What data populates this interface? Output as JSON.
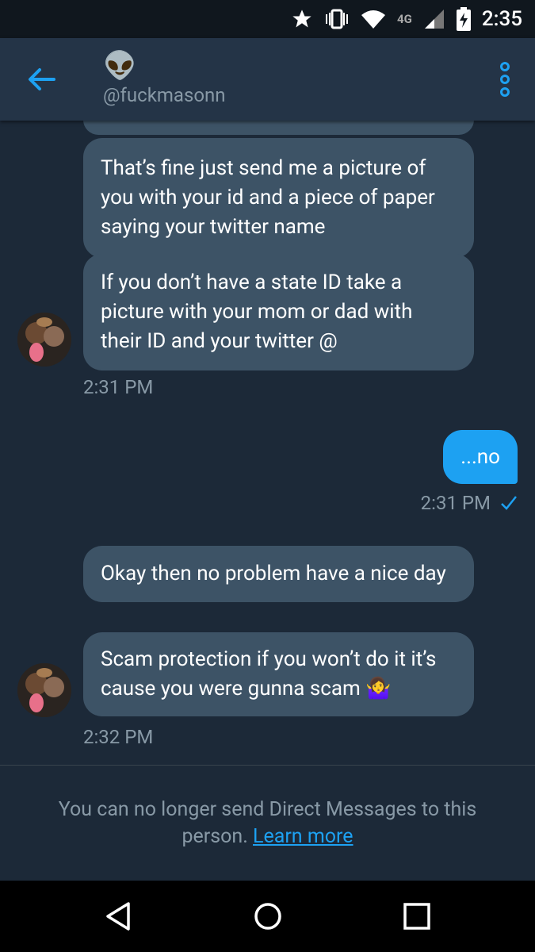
{
  "status_bar": {
    "time": "2:35",
    "network": "4G"
  },
  "header": {
    "avatar_emoji": "👽",
    "handle": "@fuckmasonn"
  },
  "messages": [
    {
      "text": "That’s fine just send me a picture of you with your id and a piece of paper saying your twitter name"
    },
    {
      "text": "If you don’t have a state ID take a picture with your mom or dad with their ID and your twitter @"
    },
    {
      "time": "2:31 PM"
    },
    {
      "text": "...no",
      "time": "2:31 PM"
    },
    {
      "text": "Okay then no problem have a nice day"
    },
    {
      "text": "Scam protection if you won’t do it it’s cause you were gunna scam 🤷‍♀️"
    },
    {
      "time": "2:32 PM"
    }
  ],
  "footer": {
    "notice": "You can no longer send Direct Messages to this person.",
    "link": "Learn more"
  },
  "colors": {
    "accent": "#1da1f2",
    "background": "#1c2938",
    "bubble_in": "#3d5366"
  }
}
